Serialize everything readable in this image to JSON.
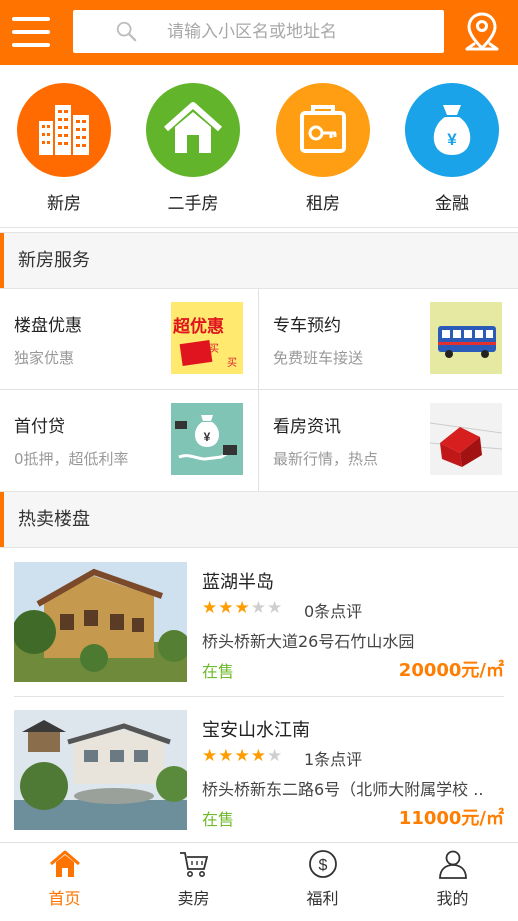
{
  "search": {
    "placeholder": "请输入小区名或地址名"
  },
  "categories": [
    {
      "label": "新房",
      "icon": "buildings-icon",
      "color": "#ff6b00"
    },
    {
      "label": "二手房",
      "icon": "house-icon",
      "color": "#62b52a"
    },
    {
      "label": "租房",
      "icon": "key-bag-icon",
      "color": "#ff9e12"
    },
    {
      "label": "金融",
      "icon": "money-bag-icon",
      "color": "#1aa3e8"
    }
  ],
  "sections": {
    "services": "新房服务",
    "hot": "热卖楼盘"
  },
  "services": [
    {
      "title": "楼盘优惠",
      "subtitle": "独家优惠",
      "icon": "discount-icon",
      "badge": "超优惠",
      "badge_sub1": "买",
      "badge_sub2": "买"
    },
    {
      "title": "专车预约",
      "subtitle": "免费班车接送",
      "icon": "bus-icon"
    },
    {
      "title": "首付贷",
      "subtitle": "0抵押，超低利率",
      "icon": "loan-hand-icon"
    },
    {
      "title": "看房资讯",
      "subtitle": "最新行情，热点",
      "icon": "house-chart-icon"
    }
  ],
  "listings": [
    {
      "name": "蓝湖半岛",
      "rating": 3,
      "reviews": "0条点评",
      "address": "桥头桥新大道26号石竹山水园",
      "status": "在售",
      "price": "20000元/㎡"
    },
    {
      "name": "宝安山水江南",
      "rating": 4,
      "reviews": "1条点评",
      "address": "桥头桥新东二路6号（北师大附属学校 ..",
      "status": "在售",
      "price": "11000元/㎡"
    }
  ],
  "tabs": [
    {
      "label": "首页",
      "icon": "home-icon",
      "active": true
    },
    {
      "label": "卖房",
      "icon": "cart-icon",
      "active": false
    },
    {
      "label": "福利",
      "icon": "dollar-coin-icon",
      "active": false
    },
    {
      "label": "我的",
      "icon": "user-icon",
      "active": false
    }
  ],
  "colors": {
    "accent": "#ff7300",
    "on_sale": "#6fb92c",
    "price": "#ff7d00",
    "star": "#ff9c00"
  }
}
